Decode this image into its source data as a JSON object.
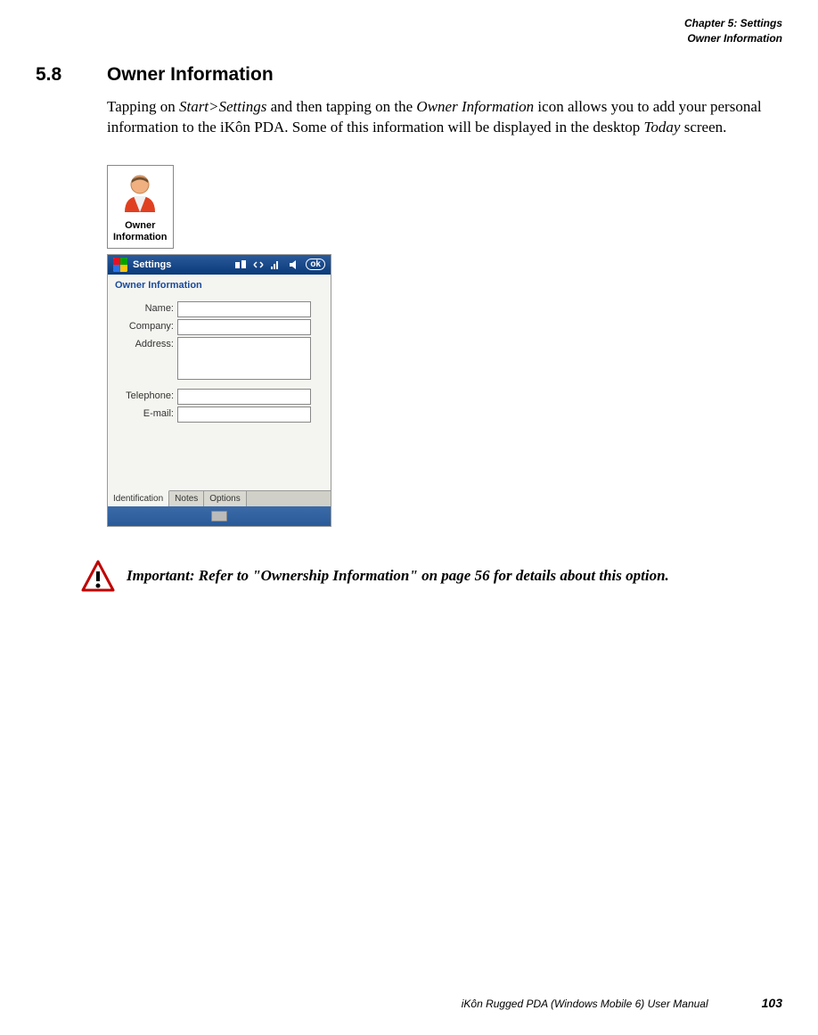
{
  "header": {
    "chapter": "Chapter 5:  Settings",
    "section": "Owner Information"
  },
  "section_number": "5.8",
  "section_title": "Owner Information",
  "body_parts": {
    "p1a": "Tapping on ",
    "p1b": "Start>Settings",
    "p1c": " and then tapping on the ",
    "p1d": "Owner Information",
    "p1e": " icon allows you to add your personal information to the iKôn PDA. Some of this information will be displayed in the desktop ",
    "p1f": "Today",
    "p1g": " screen."
  },
  "icon_block": {
    "line1": "Owner",
    "line2": "Information"
  },
  "screenshot": {
    "top_title": "Settings",
    "ok": "ok",
    "subheader": "Owner Information",
    "fields": {
      "name": "Name:",
      "company": "Company:",
      "address": "Address:",
      "telephone": "Telephone:",
      "email": "E-mail:"
    },
    "tabs": {
      "identification": "Identification",
      "notes": "Notes",
      "options": "Options"
    }
  },
  "important": "Important:  Refer to \"Ownership Information\" on page 56 for details about this option.",
  "footer": {
    "manual": "iKôn Rugged PDA (Windows Mobile 6) User Manual",
    "page": "103"
  }
}
